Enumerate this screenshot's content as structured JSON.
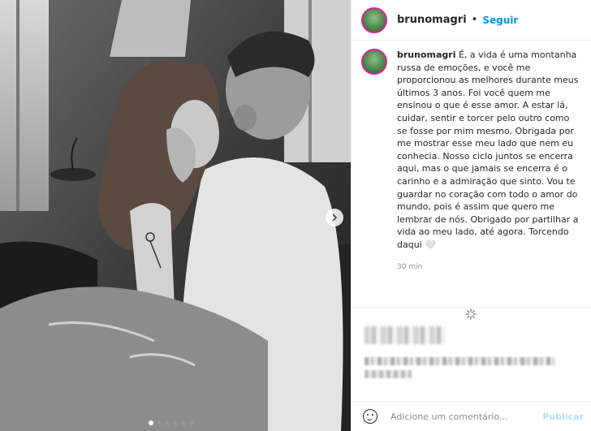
{
  "post": {
    "username": "brunomagri",
    "separator": "•",
    "follow_label": "Seguir",
    "caption": "É, a vida é uma montanha russa de emoções, e você me proporcionou as melhores durante meus últimos 3 anos. Foi você quem me ensinou o que é esse amor. A estar lá, cuidar, sentir e torcer pelo outro como se fosse por mim mesmo. Obrigada por me mostrar esse meu lado que nem eu conhecia. Nosso ciclo juntos se encerra aqui, mas o que jamais se encerra é o carinho e a admiração que sinto. Vou te guardar no coração com todo o amor do mundo, pois é assim que quero me lembrar de nós. Obrigado por partilhar a vida ao meu lado, até agora. Torcendo daqui 🤍",
    "time_ago": "30 min"
  },
  "carousel": {
    "slide_count": 6,
    "active_index": 0
  },
  "comment": {
    "placeholder": "Adicione um comentário...",
    "publish_label": "Publicar"
  },
  "icons": {
    "next": "chevron-right-icon",
    "emoji": "emoji-icon",
    "loading": "spinner-icon"
  },
  "colors": {
    "link": "#0095f6",
    "publish_disabled": "#b2dffc",
    "story_ring": "#d6249f"
  }
}
